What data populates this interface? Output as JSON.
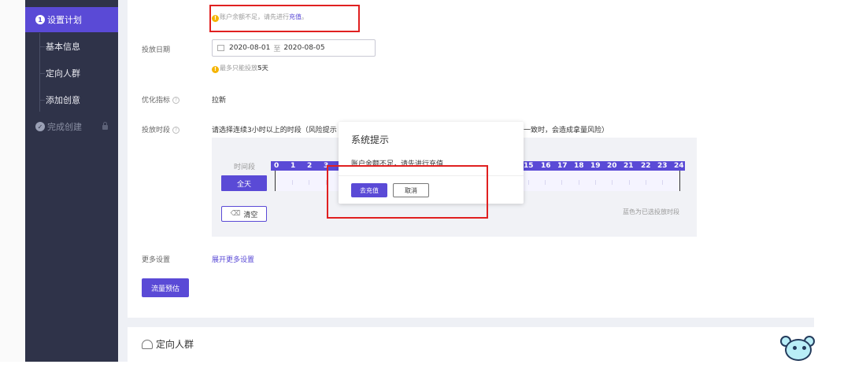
{
  "sidebar": {
    "steps": [
      {
        "number": "1",
        "label": "设置计划"
      },
      {
        "label": "基本信息"
      },
      {
        "label": "定向人群"
      },
      {
        "label": "添加创意"
      },
      {
        "label": "完成创建"
      }
    ]
  },
  "form": {
    "balance_notice": "账户余额不足，请先进行",
    "balance_link": "充值",
    "balance_end": "。",
    "date_label": "投放日期",
    "date_start": "2020-08-01",
    "date_sep": "至",
    "date_end": "2020-08-05",
    "date_notice": "最多只能投放",
    "date_notice_bold": "5天",
    "metric_label": "优化指标",
    "metric_value": "拉新",
    "period_label": "投放时段",
    "period_text_left": "请选择连续3小时以上的时段（风险提示",
    "period_text_right": "一致时，会造成拿量风险）",
    "grid_period_label": "时间段",
    "all_day": "全天",
    "clear": "清空",
    "grid_hint": "蓝色为已选投放时段",
    "hours_left": [
      "0",
      "1",
      "2",
      "3"
    ],
    "hours_right": [
      "15",
      "16",
      "17",
      "18",
      "19",
      "20",
      "21",
      "22",
      "23",
      "24"
    ],
    "more_label": "更多设置",
    "more_link": "展开更多设置",
    "estimate_button": "流量预估",
    "section2_title": "定向人群"
  },
  "dialog": {
    "title": "系统提示",
    "message": "账户余额不足，请先进行充值",
    "ok": "去充值",
    "cancel": "取消"
  },
  "colors": {
    "accent": "#5a4ad6",
    "sidebar_bg": "#2f3349",
    "highlight_box": "#e02020",
    "warning": "#f5b400"
  },
  "icons": [
    "warning-icon",
    "calendar-icon",
    "help-icon",
    "eraser-icon",
    "lock-icon",
    "people-icon",
    "mascot-icon"
  ]
}
